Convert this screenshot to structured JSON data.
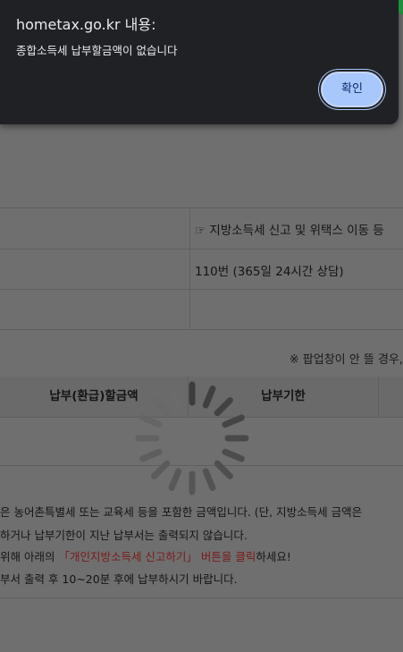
{
  "dialog": {
    "title": "hometax.go.kr 내용:",
    "message": "종합소득세 납부할금액이 없습니다",
    "ok_label": "확인"
  },
  "info_table": {
    "row1": "☞ 지방소득세 신고 및 위택스 이동 등",
    "row2": "110번 (365일 24시간 상담)"
  },
  "popup_note": "※ 팝업창이 안 뜰 경우,",
  "result_table": {
    "columns": [
      "납부(환급)할금액",
      "납부기한"
    ]
  },
  "notes": {
    "line1": "은 농어촌특별세 또는 교육세 등을 포함한 금액입니다. (단, 지방소득세 금액은",
    "line2": " 하거나 납부기한이 지난 납부서는 출력되지 않습니다.",
    "line3_a": "위해  아래의 ",
    "line3_red": "「개인지방소득세 신고하기」 버튼을 클릭",
    "line3_b": "하세요!",
    "line4": "부서 출력 후 10~20분 후에 납부하시기 바랍니다."
  },
  "colors": {
    "dialog_bg": "#202124",
    "button_bg": "#a8c7fa",
    "overlay": "#6f6f6f",
    "highlight_text": "#7a1a1a"
  }
}
